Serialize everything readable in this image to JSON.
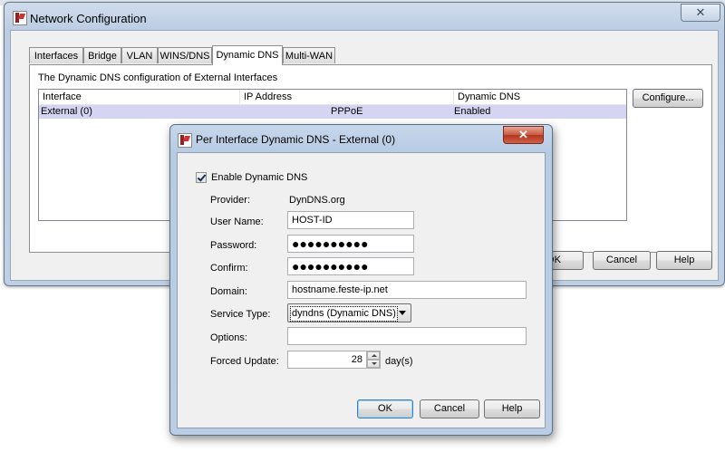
{
  "main_window": {
    "title": "Network Configuration",
    "close_glyph": "✕",
    "tabs": [
      {
        "label": "Interfaces"
      },
      {
        "label": "Bridge"
      },
      {
        "label": "VLAN"
      },
      {
        "label": "WINS/DNS"
      },
      {
        "label": "Dynamic DNS",
        "active": true
      },
      {
        "label": "Multi-WAN"
      }
    ],
    "panel_caption": "The Dynamic DNS configuration of External Interfaces",
    "table": {
      "columns": [
        "Interface",
        "IP Address",
        "Dynamic DNS"
      ],
      "rows": [
        {
          "interface": "External (0)",
          "ip_address": "PPPoE",
          "dynamic_dns": "Enabled"
        }
      ]
    },
    "configure_button": "Configure...",
    "ok_button": "OK",
    "cancel_button": "Cancel",
    "help_button": "Help"
  },
  "dialog": {
    "title": "Per Interface Dynamic DNS - External (0)",
    "close_glyph": "✕",
    "enable_label": "Enable Dynamic DNS",
    "enable_checked": true,
    "provider_label": "Provider:",
    "provider_value": "DynDNS.org",
    "username_label": "User Name:",
    "username_value": "HOST-ID",
    "password_label": "Password:",
    "password_value": "●●●●●●●●●●",
    "confirm_label": "Confirm:",
    "confirm_value": "●●●●●●●●●●",
    "domain_label": "Domain:",
    "domain_value": "hostname.feste-ip.net",
    "service_type_label": "Service Type:",
    "service_type_value": "dyndns (Dynamic DNS)",
    "options_label": "Options:",
    "options_value": "",
    "forced_update_label": "Forced Update:",
    "forced_update_value": "28",
    "forced_update_unit": "day(s)",
    "ok_button": "OK",
    "cancel_button": "Cancel",
    "help_button": "Help"
  },
  "colors": {
    "selected_row": "#d5d4f2",
    "titlebar": "#bccde3",
    "close_button_red": "#c75a42"
  },
  "icons": {
    "app_icon": "watchguard-logo-icon",
    "close": "close-icon",
    "dropdown": "chevron-down-icon",
    "spinner_up": "arrow-up-icon",
    "spinner_down": "arrow-down-icon",
    "checkbox": "checkmark-icon"
  }
}
